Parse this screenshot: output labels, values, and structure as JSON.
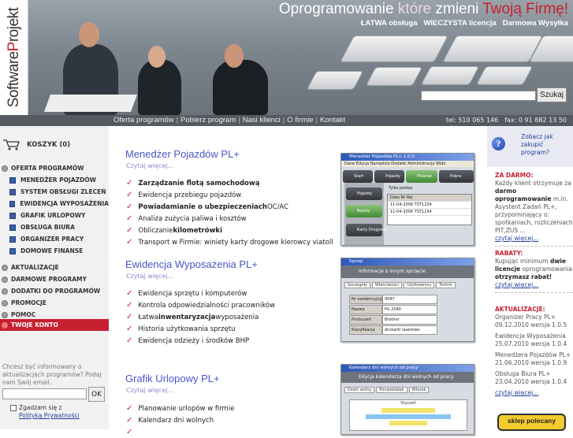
{
  "header": {
    "logo": {
      "part1": "Software",
      "part2": "P",
      "part3": "rojekt"
    },
    "headline": {
      "w1": "Oprogramowanie",
      "w2": "które",
      "w3": "zmieni",
      "w4": "Twoją Firmę!"
    },
    "subtitle": "ŁATWA obsługa   WIECZYSTA licencja   Darmowa Wysyłka",
    "search_placeholder": "",
    "search_button": "Szukaj"
  },
  "nav": {
    "links": [
      "Oferta programów",
      "Pobierz program",
      "Nasi klienci",
      "O firmie",
      "Kontakt"
    ],
    "phone": "tel: 510 065 146",
    "fax": "fax: 0 91 882 13 50"
  },
  "sidebar": {
    "cart": "KOSZYK (0)",
    "menu": [
      {
        "label": "OFERTA PROGRAMÓW",
        "type": "main"
      },
      {
        "label": "MENEDŻER POJAZDÓW",
        "type": "sub"
      },
      {
        "label": "SYSTEM OBSŁUGI ZLECEŃ",
        "type": "sub"
      },
      {
        "label": "EWIDENCJA WYPOSAŻENIA",
        "type": "sub"
      },
      {
        "label": "GRAFIK URLOPOWY",
        "type": "sub"
      },
      {
        "label": "OBSŁUGA BIURA",
        "type": "sub"
      },
      {
        "label": "ORGANIZER PRACY",
        "type": "sub"
      },
      {
        "label": "DOMOWE FINANSE",
        "type": "sub"
      },
      {
        "label": "AKTUALIZACJE",
        "type": "main"
      },
      {
        "label": "DARMOWE PROGRAMY",
        "type": "main"
      },
      {
        "label": "DODATKI DO PROGRAMÓW",
        "type": "main"
      },
      {
        "label": "PROMOCJE",
        "type": "main"
      },
      {
        "label": "POMOC",
        "type": "main"
      }
    ],
    "account": "TWOJE KONTO",
    "newsletter_text": "Chcesz być informowany o aktualizacjach programów? Podaj nam Swój email.",
    "email_value": "",
    "ok_button": "OK",
    "agree_text": "Zgadzam się z",
    "privacy_link": "Polityką Prywatności"
  },
  "products": [
    {
      "title": "Menedżer Pojazdów PL+",
      "more": "Czytaj więcej...",
      "features": [
        {
          "pre": "",
          "bold": "Zarządzanie flotą samochodową",
          "post": ""
        },
        {
          "pre": "Ewidencja przebiegu pojazdów",
          "bold": "",
          "post": ""
        },
        {
          "pre": "",
          "bold": "Powiadamianie o ubezpieczeniach",
          "post": " OC/AC"
        },
        {
          "pre": "Analiza zużycia paliwa i kosztów",
          "bold": "",
          "post": ""
        },
        {
          "pre": "Obliczanie ",
          "bold": "kilometrówki",
          "post": ""
        },
        {
          "pre": "Transport w Firmie: winiety karty drogowe kierowcy viatoll",
          "bold": "",
          "post": ""
        }
      ],
      "shot": {
        "title": "Menedżer Pojazdów PL+ 1.0.0",
        "menu": "Dane  Edycja  Narzędzia  Dodatki  Administracja  Wido",
        "tabs": [
          "Start",
          "Pojazdy",
          "Finanse",
          "Pobra"
        ],
        "side": [
          "Pojazdy",
          "Koszty",
          "Karty Drogowe"
        ],
        "grid_head": "Data        Nr Rej",
        "grid_rows": [
          "11-04-2006  TST1234",
          "11-04-2006  TST1234"
        ],
        "filter": "Tylko paliwa"
      }
    },
    {
      "title": "Ewidencja Wyposażenia PL+",
      "more": "Czytaj więcej...",
      "features": [
        {
          "pre": "Ewidencja sprzętu i komputerów",
          "bold": "",
          "post": ""
        },
        {
          "pre": "Kontrola odpowiedzialności pracowników",
          "bold": "",
          "post": ""
        },
        {
          "pre": "Łatwa ",
          "bold": "inwentaryzacja",
          "post": " wyposażenia"
        },
        {
          "pre": "Historia użytkowania sprzętu",
          "bold": "",
          "post": ""
        },
        {
          "pre": "Ewidencja odzieży i środków BHP",
          "bold": "",
          "post": ""
        }
      ],
      "shot": {
        "title": "Sprzęt",
        "banner": "Informacje o innym sprzęcie",
        "tabs": [
          "Szczegóły",
          "Właściwości",
          "Użytkownicy",
          "Termin"
        ],
        "rows": [
          {
            "label": "Nr ewidencyjny",
            "value": "4587"
          },
          {
            "label": "Nazwa",
            "value": "HL 2040"
          },
          {
            "label": "Producent",
            "value": "Brother"
          },
          {
            "label": "Klasyfikacja",
            "value": "drukarki laserowe"
          }
        ]
      }
    },
    {
      "title": "Grafik Urlopowy PL+",
      "more": "Czytaj więcej...",
      "features": [
        {
          "pre": "Planowanie urlopów w firmie",
          "bold": "",
          "post": ""
        },
        {
          "pre": "Kalendarz dni wolnych",
          "bold": "",
          "post": ""
        },
        {
          "pre": "",
          "bold": "",
          "post": ""
        }
      ],
      "shot": {
        "title": "Kalendarz dni wolnych od pracy",
        "banner": "Edycja kalendarza dni wolnych od pracy",
        "toolbar": [
          "Dzień wolny",
          "Poniedziałek",
          "Wtorek"
        ],
        "month": "Styczeń"
      }
    }
  ],
  "right": {
    "help": "Zobacz jak zakupić program?",
    "free_head": "ZA DARMO:",
    "free_text": [
      "Każdy klient otrzymuje za ",
      "darmo oprogramowanie",
      " m.in. Asystent Zadań PL+, przypominający o: spotkaniach, rozliczeniach PIT,ZUS ..."
    ],
    "free_more": "czytaj więcej...",
    "rebate_head": "RABATY:",
    "rebate_text": [
      "Kupując minimum ",
      "dwie licencje",
      " oprogramowania ",
      "otrzymasz rabat!"
    ],
    "rebate_more": "czytaj więcej...",
    "updates_head": "AKTUALIZACJE:",
    "updates": [
      {
        "name": "Organizer Pracy PL+",
        "info": "09.12.2010 wersja 1.0.5"
      },
      {
        "name": "Ewidencja Wyposażenia",
        "info": "25.07.2010 wersja 1.0.4"
      },
      {
        "name": "Menedżera Pojazdów PL+",
        "info": "21.06.2010 wersja 1.0.9"
      },
      {
        "name": "Obsługa Biura PL+",
        "info": "23.04.2010 wersja 1.0.4"
      }
    ],
    "updates_more": "czytaj więcej...",
    "badge": "sklep polecany"
  }
}
